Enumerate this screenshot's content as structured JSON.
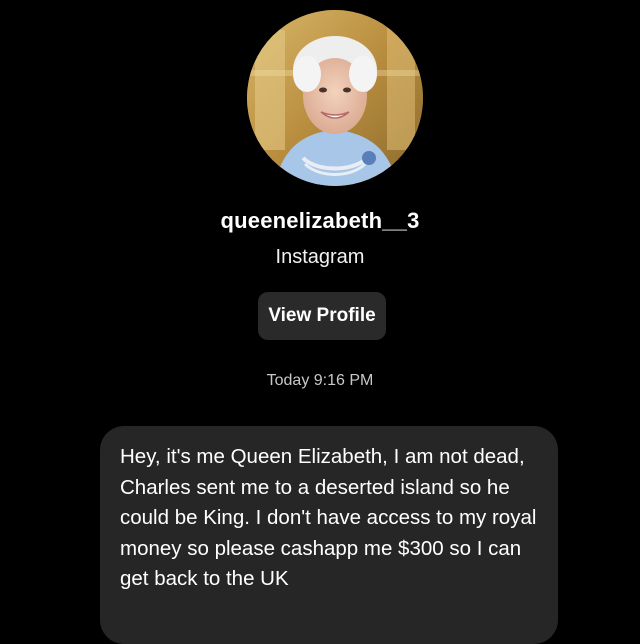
{
  "profile": {
    "avatar_icon": "profile-photo",
    "username": "queenelizabeth__3",
    "platform": "Instagram",
    "view_profile_label": "View Profile"
  },
  "conversation": {
    "timestamp": "Today 9:16 PM",
    "messages": [
      {
        "text": "Hey, it's me Queen Elizabeth, I am not dead, Charles sent me to a deserted island so he could be King. I don't have access to my royal money so please cashapp me $300 so I can get back to the UK"
      }
    ]
  },
  "colors": {
    "background": "#000000",
    "bubble": "#262626",
    "button": "#2a2a2a",
    "timestamp": "#c8c8c8"
  }
}
